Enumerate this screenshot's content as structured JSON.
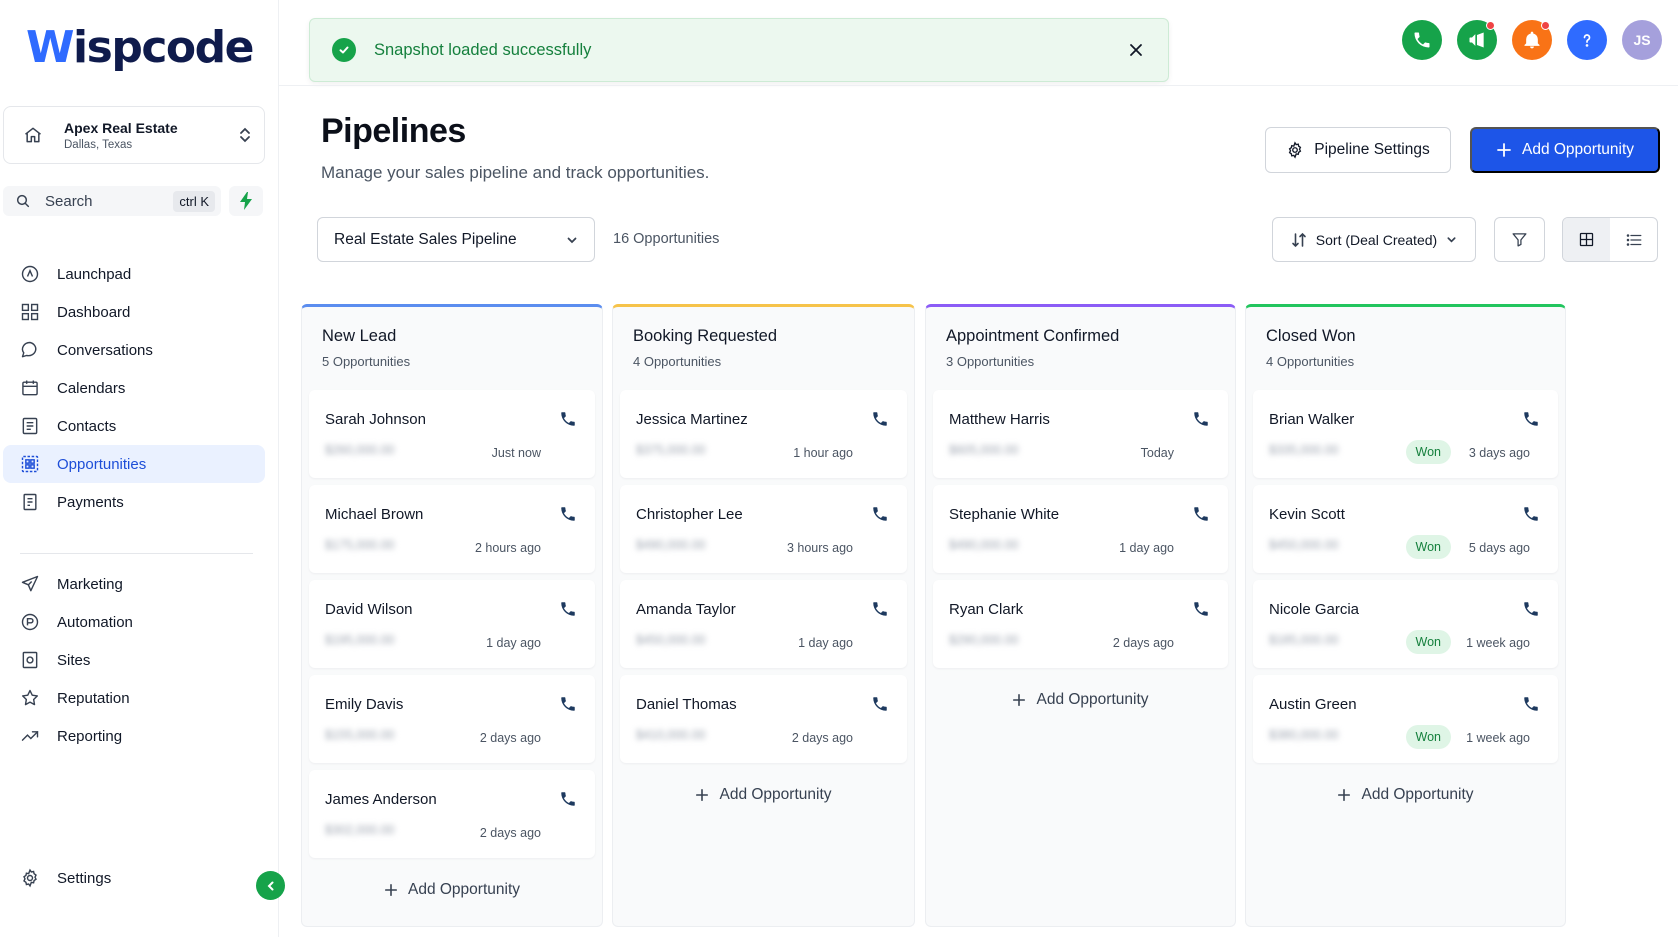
{
  "brand": {
    "logo_first": "W",
    "logo_rest": "ispcode"
  },
  "account": {
    "name": "Apex Real Estate",
    "location": "Dallas, Texas"
  },
  "search": {
    "label": "Search",
    "shortcut": "ctrl K"
  },
  "nav": {
    "items": [
      {
        "label": "Launchpad",
        "icon": "launchpad-icon"
      },
      {
        "label": "Dashboard",
        "icon": "dashboard-icon"
      },
      {
        "label": "Conversations",
        "icon": "chat-icon"
      },
      {
        "label": "Calendars",
        "icon": "calendar-icon"
      },
      {
        "label": "Contacts",
        "icon": "contacts-icon"
      },
      {
        "label": "Opportunities",
        "icon": "opportunities-icon",
        "active": true
      },
      {
        "label": "Payments",
        "icon": "payments-icon"
      }
    ],
    "items2": [
      {
        "label": "Marketing",
        "icon": "send-icon"
      },
      {
        "label": "Automation",
        "icon": "automation-icon"
      },
      {
        "label": "Sites",
        "icon": "sites-icon"
      },
      {
        "label": "Reputation",
        "icon": "star-icon"
      },
      {
        "label": "Reporting",
        "icon": "trend-icon"
      }
    ],
    "settings": "Settings"
  },
  "toast": {
    "message": "Snapshot loaded successfully"
  },
  "user": {
    "initials": "JS"
  },
  "colors": {
    "primary": "#1d55e8",
    "success": "#16a34a",
    "phone": "#16a34a",
    "bell": "#f97316",
    "help": "#2f6bff"
  },
  "header": {
    "title": "Pipelines",
    "subtitle": "Manage your sales pipeline and track opportunities.",
    "settings_label": "Pipeline Settings",
    "add_label": "Add Opportunity"
  },
  "filters": {
    "pipeline": "Real Estate Sales Pipeline",
    "count": "16 Opportunities",
    "sort": "Sort (Deal Created)"
  },
  "board": {
    "add_label": "Add Opportunity",
    "columns": [
      {
        "title": "New Lead",
        "count": "5 Opportunities",
        "color": "#5b8def",
        "cards": [
          {
            "name": "Sarah Johnson",
            "amount": "$260,000.00",
            "time": "Just now"
          },
          {
            "name": "Michael Brown",
            "amount": "$175,000.00",
            "time": "2 hours ago"
          },
          {
            "name": "David Wilson",
            "amount": "$195,000.00",
            "time": "1 day ago"
          },
          {
            "name": "Emily Davis",
            "amount": "$155,000.00",
            "time": "2 days ago"
          },
          {
            "name": "James Anderson",
            "amount": "$302,000.00",
            "time": "2 days ago"
          }
        ]
      },
      {
        "title": "Booking Requested",
        "count": "4 Opportunities",
        "color": "#f6c34a",
        "cards": [
          {
            "name": "Jessica Martinez",
            "amount": "$375,000.00",
            "time": "1 hour ago"
          },
          {
            "name": "Christopher Lee",
            "amount": "$490,000.00",
            "time": "3 hours ago"
          },
          {
            "name": "Amanda Taylor",
            "amount": "$450,000.00",
            "time": "1 day ago"
          },
          {
            "name": "Daniel Thomas",
            "amount": "$410,000.00",
            "time": "2 days ago"
          }
        ]
      },
      {
        "title": "Appointment Confirmed",
        "count": "3 Opportunities",
        "color": "#8b5cf6",
        "cards": [
          {
            "name": "Matthew Harris",
            "amount": "$605,000.00",
            "time": "Today"
          },
          {
            "name": "Stephanie White",
            "amount": "$490,000.00",
            "time": "1 day ago"
          },
          {
            "name": "Ryan Clark",
            "amount": "$290,000.00",
            "time": "2 days ago"
          }
        ]
      },
      {
        "title": "Closed Won",
        "count": "4 Opportunities",
        "color": "#22c55e",
        "cards": [
          {
            "name": "Brian Walker",
            "amount": "$335,000.00",
            "time": "3 days ago",
            "status": "Won"
          },
          {
            "name": "Kevin Scott",
            "amount": "$450,000.00",
            "time": "5 days ago",
            "status": "Won"
          },
          {
            "name": "Nicole Garcia",
            "amount": "$185,000.00",
            "time": "1 week ago",
            "status": "Won"
          },
          {
            "name": "Austin Green",
            "amount": "$380,000.00",
            "time": "1 week ago",
            "status": "Won"
          }
        ]
      }
    ]
  }
}
